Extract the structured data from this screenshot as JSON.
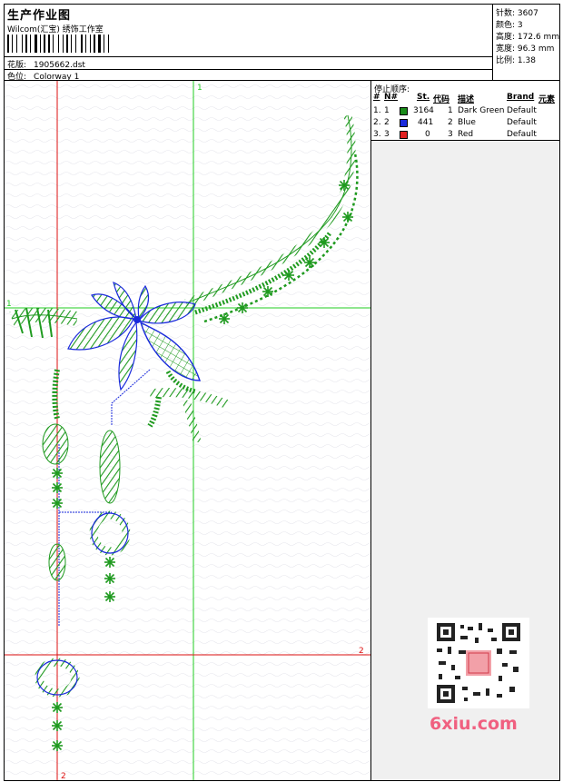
{
  "header": {
    "title": "生产作业图",
    "studio": "Wilcom(汇宝) 绣饰工作室",
    "design_label": "花版:",
    "design_file": "1905662.dst",
    "colorway_label": "色位:",
    "colorway": "Colorway 1"
  },
  "stats": [
    {
      "label": "针数:",
      "value": "3607"
    },
    {
      "label": "颜色:",
      "value": "3"
    },
    {
      "label": "高度:",
      "value": "172.6 mm"
    },
    {
      "label": "宽度:",
      "value": "96.3 mm"
    },
    {
      "label": "比例:",
      "value": "1.38"
    }
  ],
  "stop_sequence": {
    "title": "停止顺序:",
    "columns": [
      "#",
      "N#",
      "St.",
      "代码",
      "描述",
      "Brand",
      "元素"
    ],
    "rows": [
      {
        "num": "1.",
        "n": "1",
        "color": "#1a8c1a",
        "st": "3164",
        "code": "1",
        "desc": "Dark Green",
        "brand": "Default"
      },
      {
        "num": "2.",
        "n": "2",
        "color": "#1a2adc",
        "st": "441",
        "code": "2",
        "desc": "Blue",
        "brand": "Default"
      },
      {
        "num": "3.",
        "n": "3",
        "color": "#e02020",
        "st": "0",
        "code": "3",
        "desc": "Red",
        "brand": "Default"
      }
    ]
  },
  "guides": {
    "green_v_label": "1",
    "green_h_label": "1",
    "red_h_label": "2",
    "red_v_label": "2"
  },
  "colors": {
    "stitch_green": "#1f9a1f",
    "stitch_blue": "#1a2adc",
    "guide_green": "#22cc22",
    "guide_red": "#dd1111"
  },
  "watermark": {
    "text": "6xiu.com"
  }
}
